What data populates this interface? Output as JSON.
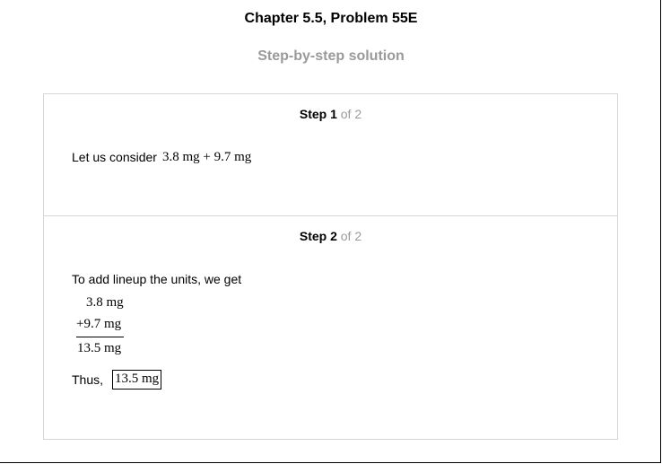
{
  "title": "Chapter 5.5, Problem 55E",
  "subtitle": "Step-by-step solution",
  "steps": [
    {
      "label": "Step 1",
      "of": "of 2",
      "intro": "Let us consider",
      "expression": "3.8 mg + 9.7 mg"
    },
    {
      "label": "Step 2",
      "of": "of 2",
      "intro": "To add lineup the units, we get",
      "addend1": "3.8 mg",
      "addend2": "+9.7 mg",
      "sum": "13.5 mg",
      "thus": "Thus,",
      "answer": "13.5 mg"
    }
  ]
}
